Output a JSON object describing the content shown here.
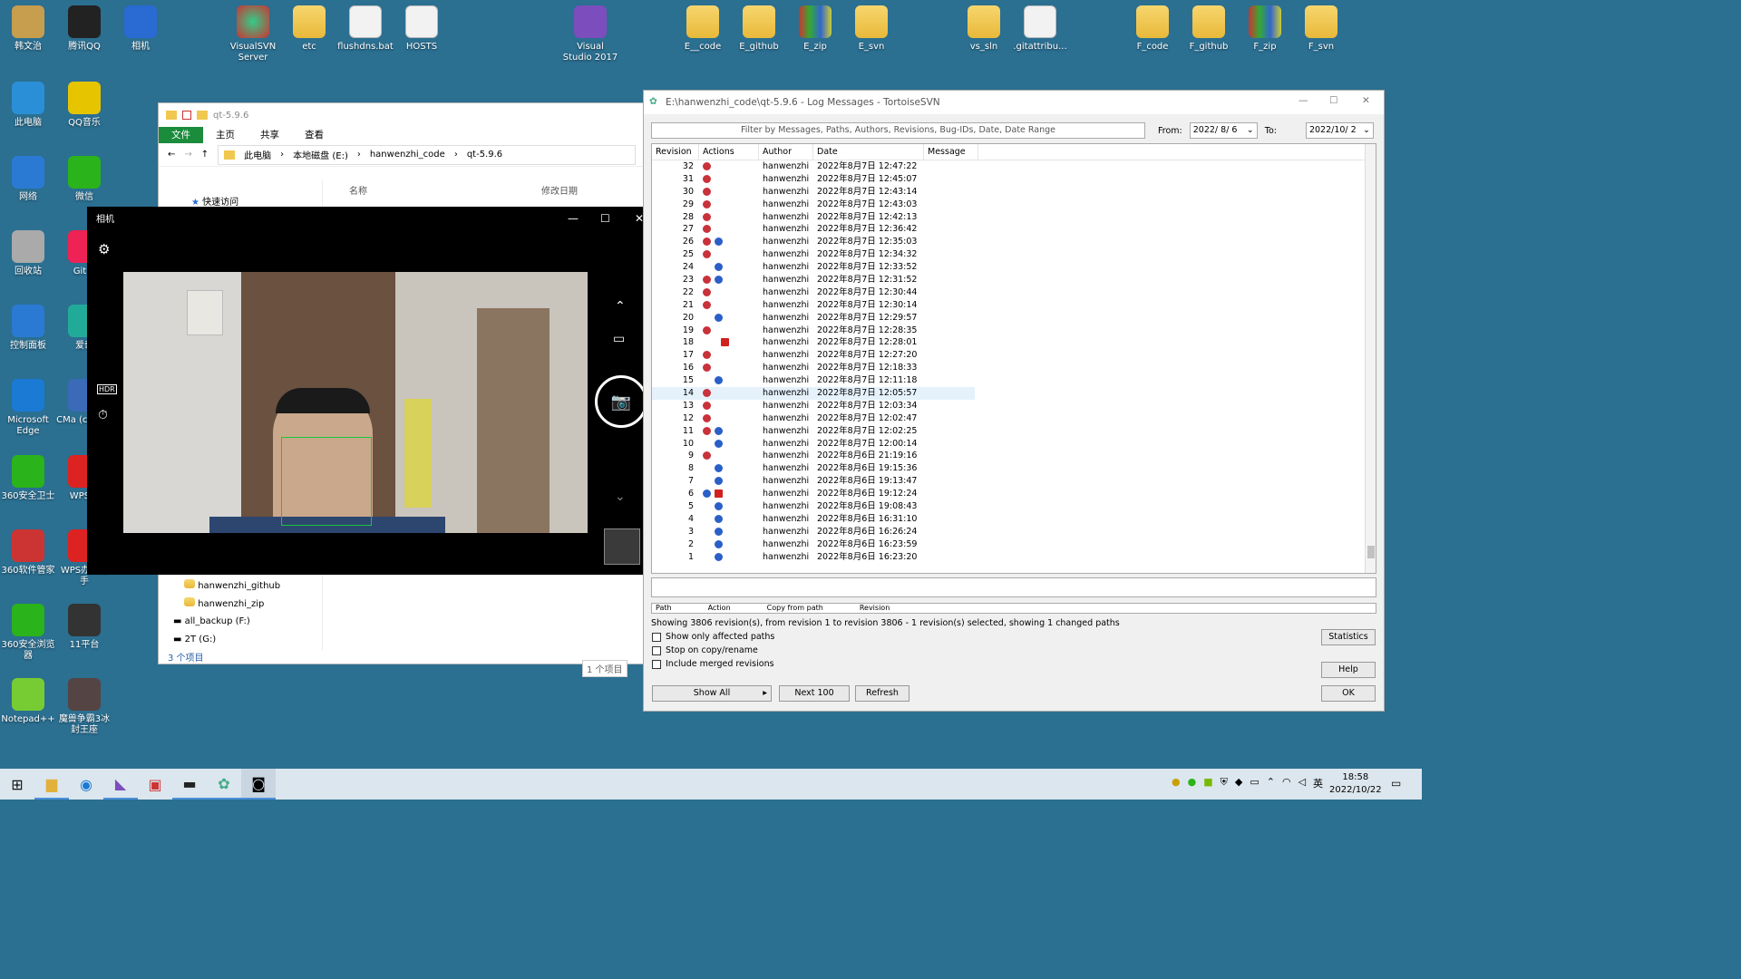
{
  "desktop": {
    "icons_left": [
      {
        "label": "韩文治"
      },
      {
        "label": "腾讯QQ"
      },
      {
        "label": "相机"
      },
      {
        "label": "此电脑"
      },
      {
        "label": "QQ音乐"
      },
      {
        "label": "网络"
      },
      {
        "label": "微信"
      },
      {
        "label": "回收站"
      },
      {
        "label": "Git B"
      },
      {
        "label": "控制面板"
      },
      {
        "label": "爱奇"
      },
      {
        "label": "Microsoft Edge"
      },
      {
        "label": "CMa (cmake"
      },
      {
        "label": "360安全卫士"
      },
      {
        "label": "WPS C"
      },
      {
        "label": "360软件管家"
      },
      {
        "label": "WPS办公助手"
      },
      {
        "label": "360安全浏览器"
      },
      {
        "label": "11平台"
      },
      {
        "label": "Notepad++"
      },
      {
        "label": "魔兽争霸3冰封王座"
      }
    ],
    "icons_top": [
      {
        "label": "VisualSVN Server"
      },
      {
        "label": "etc"
      },
      {
        "label": "flushdns.bat"
      },
      {
        "label": "HOSTS"
      },
      {
        "label": "Visual Studio 2017"
      },
      {
        "label": "E__code"
      },
      {
        "label": "E_github"
      },
      {
        "label": "E_zip"
      },
      {
        "label": "E_svn"
      },
      {
        "label": "vs_sln"
      },
      {
        "label": ".gitattribu..."
      },
      {
        "label": "F_code"
      },
      {
        "label": "F_github"
      },
      {
        "label": "F_zip"
      },
      {
        "label": "F_svn"
      }
    ]
  },
  "explorer": {
    "title": "qt-5.9.6",
    "tabs": [
      "文件",
      "主页",
      "共享",
      "查看"
    ],
    "path": [
      "此电脑",
      "本地磁盘 (E:)",
      "hanwenzhi_code",
      "qt-5.9.6"
    ],
    "quick_access": "快速访问",
    "col_name": "名称",
    "col_modified": "修改日期",
    "tree": [
      "hanwenzhi_github",
      "hanwenzhi_zip",
      "all_backup (F:)",
      "2T (G:)"
    ],
    "status": "3 个项目",
    "status2": "1 个项目"
  },
  "camera": {
    "title": "相机"
  },
  "svn": {
    "title": "E:\\hanwenzhi_code\\qt-5.9.6 - Log Messages - TortoiseSVN",
    "filter_placeholder": "Filter by Messages, Paths, Authors, Revisions, Bug-IDs, Date, Date Range",
    "from_label": "From:",
    "from_value": "2022/ 8/ 6",
    "to_label": "To:",
    "to_value": "2022/10/ 2",
    "headers": {
      "rev": "Revision",
      "actions": "Actions",
      "author": "Author",
      "date": "Date",
      "message": "Message"
    },
    "paths_headers": [
      "Path",
      "Action",
      "Copy from path",
      "Revision"
    ],
    "status_line": "Showing 3806 revision(s), from revision 1 to revision 3806 - 1 revision(s) selected, showing 1 changed paths",
    "chk1": "Show only affected paths",
    "chk2": "Stop on copy/rename",
    "chk3": "Include merged revisions",
    "btn_show_all": "Show All",
    "btn_next": "Next 100",
    "btn_refresh": "Refresh",
    "btn_statistics": "Statistics",
    "btn_help": "Help",
    "btn_ok": "OK",
    "rows": [
      {
        "rev": "32",
        "acts": "m",
        "author": "hanwenzhi",
        "date": "2022年8月7日 12:47:22"
      },
      {
        "rev": "31",
        "acts": "m",
        "author": "hanwenzhi",
        "date": "2022年8月7日 12:45:07"
      },
      {
        "rev": "30",
        "acts": "m",
        "author": "hanwenzhi",
        "date": "2022年8月7日 12:43:14"
      },
      {
        "rev": "29",
        "acts": "m",
        "author": "hanwenzhi",
        "date": "2022年8月7日 12:43:03"
      },
      {
        "rev": "28",
        "acts": "m",
        "author": "hanwenzhi",
        "date": "2022年8月7日 12:42:13"
      },
      {
        "rev": "27",
        "acts": "m",
        "author": "hanwenzhi",
        "date": "2022年8月7日 12:36:42"
      },
      {
        "rev": "26",
        "acts": "ma",
        "author": "hanwenzhi",
        "date": "2022年8月7日 12:35:03"
      },
      {
        "rev": "25",
        "acts": "m",
        "author": "hanwenzhi",
        "date": "2022年8月7日 12:34:32"
      },
      {
        "rev": "24",
        "acts": "a",
        "author": "hanwenzhi",
        "date": "2022年8月7日 12:33:52"
      },
      {
        "rev": "23",
        "acts": "ma",
        "author": "hanwenzhi",
        "date": "2022年8月7日 12:31:52"
      },
      {
        "rev": "22",
        "acts": "m",
        "author": "hanwenzhi",
        "date": "2022年8月7日 12:30:44"
      },
      {
        "rev": "21",
        "acts": "m",
        "author": "hanwenzhi",
        "date": "2022年8月7日 12:30:14"
      },
      {
        "rev": "20",
        "acts": "a",
        "author": "hanwenzhi",
        "date": "2022年8月7日 12:29:57"
      },
      {
        "rev": "19",
        "acts": "m",
        "author": "hanwenzhi",
        "date": "2022年8月7日 12:28:35"
      },
      {
        "rev": "18",
        "acts": "d",
        "author": "hanwenzhi",
        "date": "2022年8月7日 12:28:01"
      },
      {
        "rev": "17",
        "acts": "m",
        "author": "hanwenzhi",
        "date": "2022年8月7日 12:27:20"
      },
      {
        "rev": "16",
        "acts": "m",
        "author": "hanwenzhi",
        "date": "2022年8月7日 12:18:33"
      },
      {
        "rev": "15",
        "acts": "a",
        "author": "hanwenzhi",
        "date": "2022年8月7日 12:11:18"
      },
      {
        "rev": "14",
        "acts": "m",
        "author": "hanwenzhi",
        "date": "2022年8月7日 12:05:57",
        "selected": true
      },
      {
        "rev": "13",
        "acts": "m",
        "author": "hanwenzhi",
        "date": "2022年8月7日 12:03:34"
      },
      {
        "rev": "12",
        "acts": "m",
        "author": "hanwenzhi",
        "date": "2022年8月7日 12:02:47"
      },
      {
        "rev": "11",
        "acts": "ma",
        "author": "hanwenzhi",
        "date": "2022年8月7日 12:02:25"
      },
      {
        "rev": "10",
        "acts": "a",
        "author": "hanwenzhi",
        "date": "2022年8月7日 12:00:14"
      },
      {
        "rev": "9",
        "acts": "m",
        "author": "hanwenzhi",
        "date": "2022年8月6日 21:19:16"
      },
      {
        "rev": "8",
        "acts": "a",
        "author": "hanwenzhi",
        "date": "2022年8月6日 19:15:36"
      },
      {
        "rev": "7",
        "acts": "a",
        "author": "hanwenzhi",
        "date": "2022年8月6日 19:13:47"
      },
      {
        "rev": "6",
        "acts": "ad",
        "author": "hanwenzhi",
        "date": "2022年8月6日 19:12:24"
      },
      {
        "rev": "5",
        "acts": "a",
        "author": "hanwenzhi",
        "date": "2022年8月6日 19:08:43"
      },
      {
        "rev": "4",
        "acts": "a",
        "author": "hanwenzhi",
        "date": "2022年8月6日 16:31:10"
      },
      {
        "rev": "3",
        "acts": "a",
        "author": "hanwenzhi",
        "date": "2022年8月6日 16:26:24"
      },
      {
        "rev": "2",
        "acts": "a",
        "author": "hanwenzhi",
        "date": "2022年8月6日 16:23:59"
      },
      {
        "rev": "1",
        "acts": "a",
        "author": "hanwenzhi",
        "date": "2022年8月6日 16:23:20"
      }
    ]
  },
  "taskbar": {
    "time": "18:58",
    "date": "2022/10/22",
    "ime": "英"
  },
  "colors": {
    "desktop": "#2b6f91",
    "explorer_file_tab": "#1b8b3c",
    "selection": "#e5f1fb"
  }
}
